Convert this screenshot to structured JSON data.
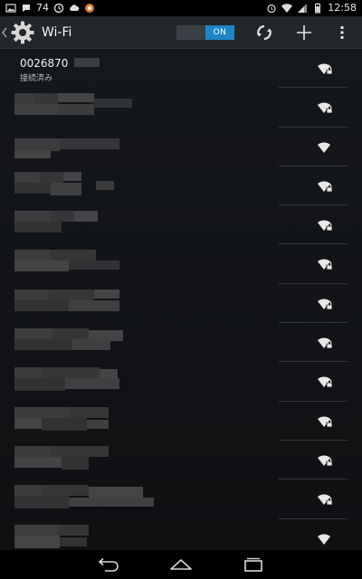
{
  "status_bar": {
    "battery_percent_label": "74",
    "time": "12:58",
    "left_icons": [
      "image-icon",
      "notification-icon",
      "sync-icon",
      "cloud-icon",
      "app-icon"
    ],
    "right_icons": [
      "alarm-icon",
      "wifi-icon",
      "signal-icon",
      "battery-icon"
    ]
  },
  "action_bar": {
    "title": "Wi-Fi",
    "toggle_label": "ON",
    "actions": [
      "wps-icon",
      "add-icon",
      "overflow-menu-icon"
    ]
  },
  "networks": [
    {
      "name": "0026870",
      "status": "接続済み",
      "locked": true,
      "obscured": false
    },
    {
      "locked": true,
      "obscured": true
    },
    {
      "locked": false,
      "obscured": true
    },
    {
      "locked": true,
      "obscured": true
    },
    {
      "locked": true,
      "obscured": true
    },
    {
      "locked": true,
      "obscured": true
    },
    {
      "locked": true,
      "obscured": true
    },
    {
      "locked": true,
      "obscured": true
    },
    {
      "locked": true,
      "obscured": true
    },
    {
      "locked": true,
      "obscured": true
    },
    {
      "locked": true,
      "obscured": true
    },
    {
      "locked": true,
      "obscured": true
    },
    {
      "locked": false,
      "obscured": true
    }
  ],
  "nav_bar": [
    "back-icon",
    "home-icon",
    "recents-icon"
  ],
  "colors": {
    "toggle_on": "#1f86c6",
    "action_bar_bg": "#23272b",
    "list_bg": "#131619",
    "blur_block": "#3b3f43"
  }
}
